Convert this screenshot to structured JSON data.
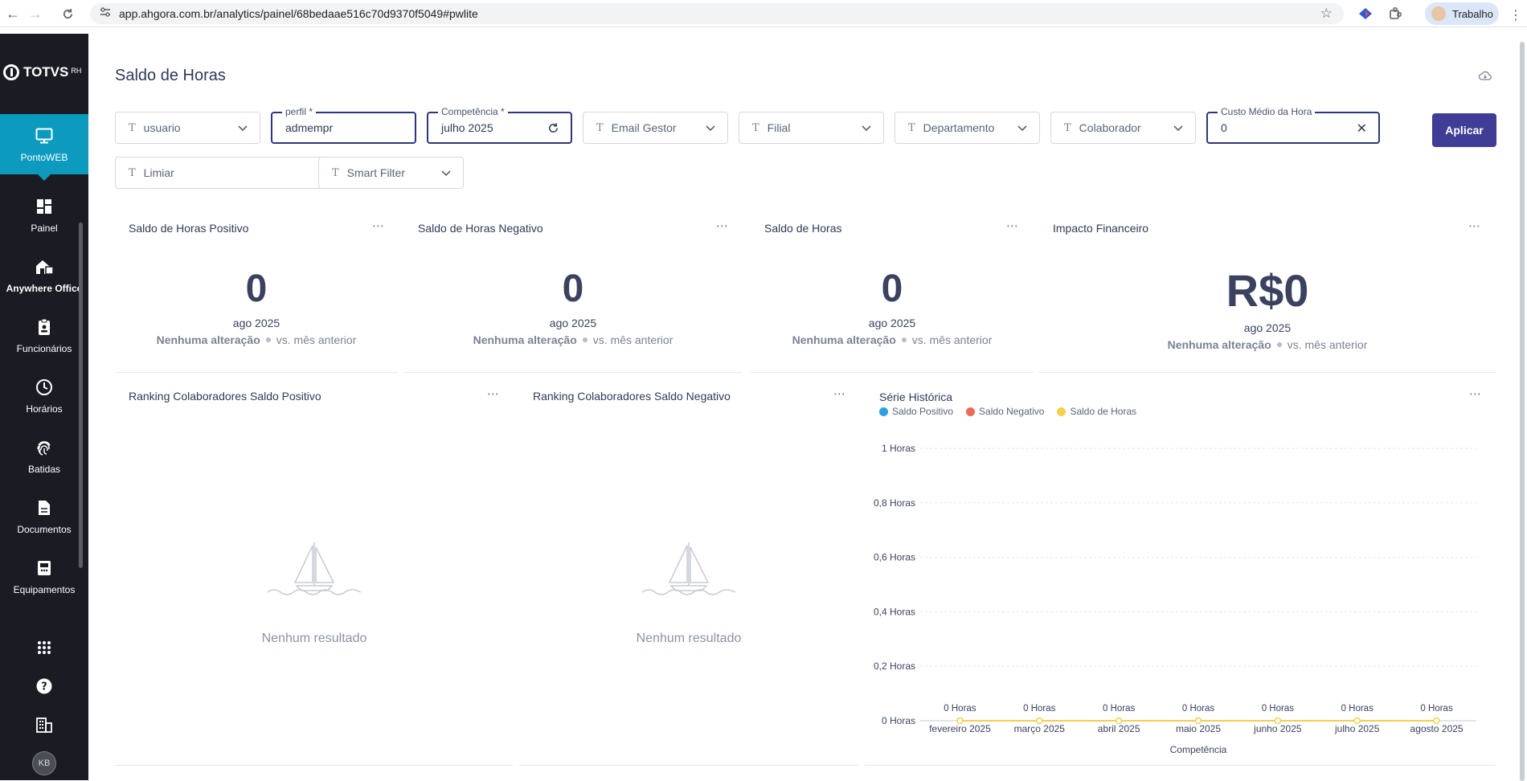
{
  "browser": {
    "url": "app.ahgora.com.br/analytics/painel/68bedaae516c70d9370f5049#pwlite",
    "profile_label": "Trabalho"
  },
  "sidebar": {
    "logo_text": "TOTVS",
    "logo_suffix": "RH",
    "items": [
      {
        "label": "PontoWEB",
        "icon": "monitor-icon"
      },
      {
        "label": "Painel",
        "icon": "dashboard-grid-icon"
      },
      {
        "label": "Anywhere Office",
        "icon": "home-office-icon"
      },
      {
        "label": "Funcionários",
        "icon": "badge-icon"
      },
      {
        "label": "Horários",
        "icon": "clock-icon"
      },
      {
        "label": "Batidas",
        "icon": "fingerprint-icon"
      },
      {
        "label": "Documentos",
        "icon": "document-icon"
      },
      {
        "label": "Equipamentos",
        "icon": "equipment-icon"
      }
    ],
    "user_initials": "KB"
  },
  "page": {
    "title": "Saldo de Horas"
  },
  "filters": {
    "usuario": {
      "placeholder": "usuario"
    },
    "perfil": {
      "label": "perfil *",
      "value": "admempr"
    },
    "competencia": {
      "label": "Competência *",
      "value": "julho 2025"
    },
    "email_gestor": {
      "placeholder": "Email Gestor"
    },
    "filial": {
      "placeholder": "Filial"
    },
    "departamento": {
      "placeholder": "Departamento"
    },
    "colaborador": {
      "placeholder": "Colaborador"
    },
    "custo_medio": {
      "label": "Custo Médio da Hora",
      "value": "0"
    },
    "limiar": {
      "placeholder": "Limiar"
    },
    "smart_filter": {
      "placeholder": "Smart Filter"
    },
    "apply_label": "Aplicar"
  },
  "kpis": [
    {
      "title": "Saldo de Horas Positivo",
      "value": "0",
      "period": "ago 2025",
      "change": "Nenhuma alteração",
      "comparison": "vs. mês anterior"
    },
    {
      "title": "Saldo de Horas Negativo",
      "value": "0",
      "period": "ago 2025",
      "change": "Nenhuma alteração",
      "comparison": "vs. mês anterior"
    },
    {
      "title": "Saldo de Horas",
      "value": "0",
      "period": "ago 2025",
      "change": "Nenhuma alteração",
      "comparison": "vs. mês anterior"
    },
    {
      "title": "Impacto Financeiro",
      "value": "R$0",
      "period": "ago 2025",
      "change": "Nenhuma alteração",
      "comparison": "vs. mês anterior"
    }
  ],
  "rankings": [
    {
      "title": "Ranking Colaboradores Saldo Positivo",
      "empty_text": "Nenhum resultado"
    },
    {
      "title": "Ranking Colaboradores Saldo Negativo",
      "empty_text": "Nenhum resultado"
    }
  ],
  "colors": {
    "accent": "#0c9abe",
    "button": "#3f3d95",
    "saldo_positivo": "#2f9fe4",
    "saldo_negativo": "#ef6a54",
    "saldo_horas": "#f5cf4e"
  },
  "chart_data": {
    "type": "line",
    "title": "Série Histórica",
    "xlabel": "Competência",
    "ylabel": "",
    "categories": [
      "fevereiro 2025",
      "março 2025",
      "abril 2025",
      "maio 2025",
      "junho 2025",
      "julho 2025",
      "agosto 2025"
    ],
    "y_ticks": [
      "0 Horas",
      "0,2 Horas",
      "0,4 Horas",
      "0,6 Horas",
      "0,8 Horas",
      "1 Horas"
    ],
    "ylim": [
      0,
      1
    ],
    "grid": true,
    "legend_position": "top-left",
    "series": [
      {
        "name": "Saldo Positivo",
        "values": [
          0,
          0,
          0,
          0,
          0,
          0,
          0
        ]
      },
      {
        "name": "Saldo Negativo",
        "values": [
          0,
          0,
          0,
          0,
          0,
          0,
          0
        ]
      },
      {
        "name": "Saldo de Horas",
        "values": [
          0,
          0,
          0,
          0,
          0,
          0,
          0
        ]
      }
    ],
    "data_labels": [
      "0 Horas",
      "0 Horas",
      "0 Horas",
      "0 Horas",
      "0 Horas",
      "0 Horas",
      "0 Horas"
    ]
  }
}
